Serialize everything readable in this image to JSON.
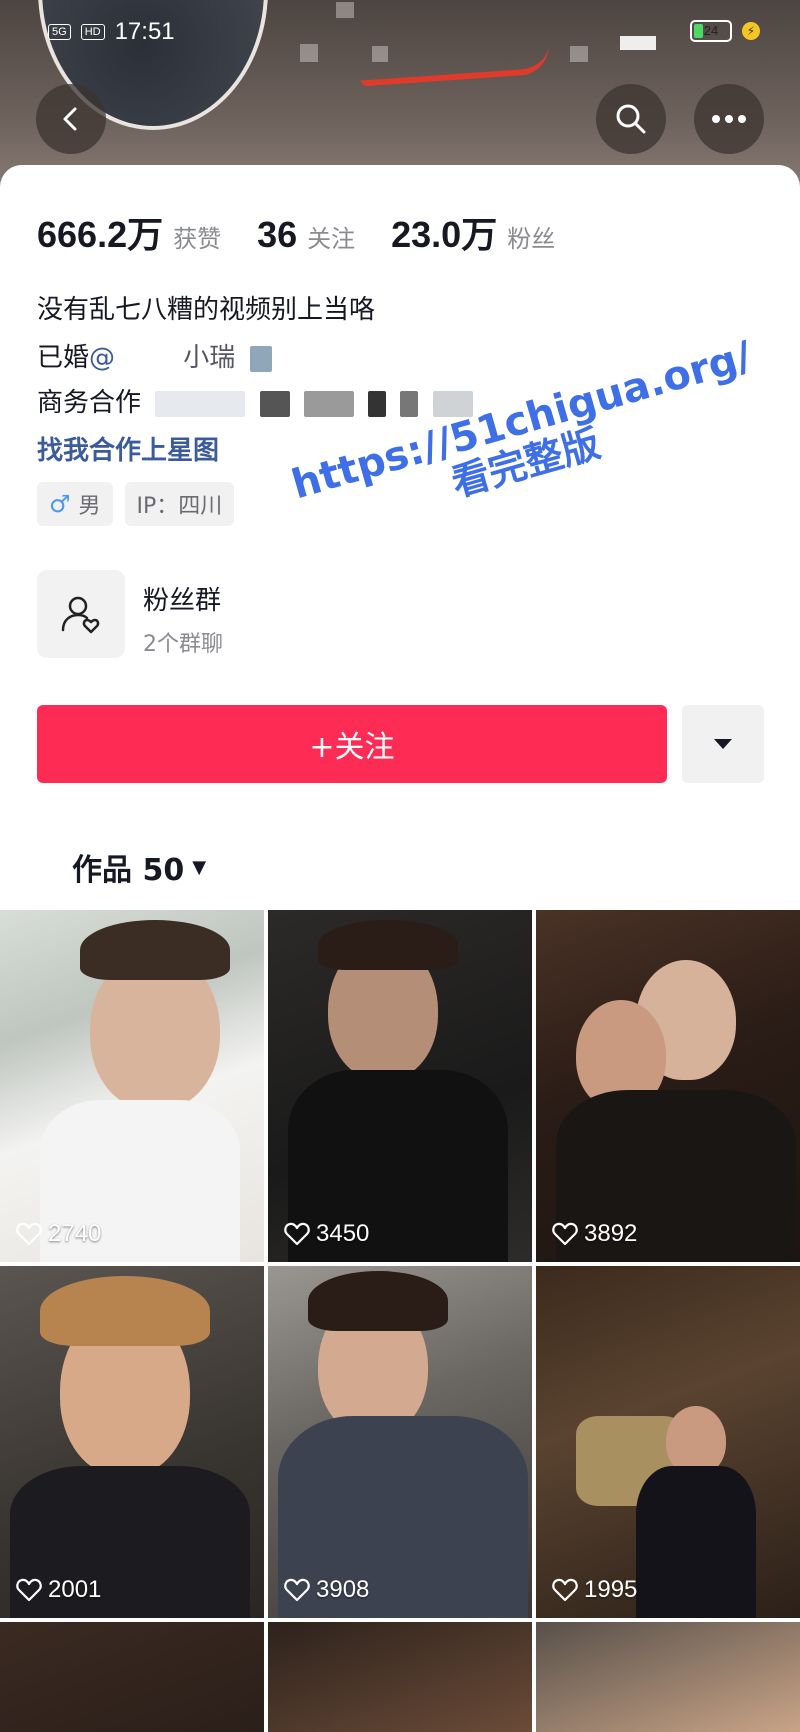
{
  "status_bar": {
    "network": "5G",
    "hd": "HD",
    "time": "17:51",
    "battery": "24",
    "battery_level": 0.24
  },
  "header": {
    "back_icon": "chevron-left-icon",
    "search_icon": "search-icon",
    "more_icon": "more-dots-icon"
  },
  "stats": [
    {
      "value": "666.2万",
      "label": "获赞"
    },
    {
      "value": "36",
      "label": "关注"
    },
    {
      "value": "23.0万",
      "label": "粉丝"
    }
  ],
  "bio": {
    "line1": "没有乱七八糟的视频别上当咯",
    "line2_prefix": "已婚",
    "line2_mention": "@",
    "line2_partial": "小瑞",
    "line3": "商务合作",
    "link": "找我合作上星图"
  },
  "tags": {
    "gender_icon": "male-icon",
    "gender": "男",
    "ip": "IP：四川"
  },
  "fan_group": {
    "icon": "fan-group-icon",
    "title": "粉丝群",
    "subtitle": "2个群聊"
  },
  "actions": {
    "follow": "+关注",
    "dropdown_icon": "triangle-down-icon"
  },
  "works_tab": {
    "label": "作品 50"
  },
  "watermark": {
    "url": "https://51chigua.org/",
    "text": "看完整版"
  },
  "videos": [
    {
      "likes": "2740"
    },
    {
      "likes": "3450"
    },
    {
      "likes": "3892"
    },
    {
      "likes": "2001"
    },
    {
      "likes": "3908"
    },
    {
      "likes": "1995"
    }
  ],
  "colors": {
    "follow": "#fe2c55",
    "link": "#3b5b9a",
    "watermark": "#3f6fe6"
  }
}
